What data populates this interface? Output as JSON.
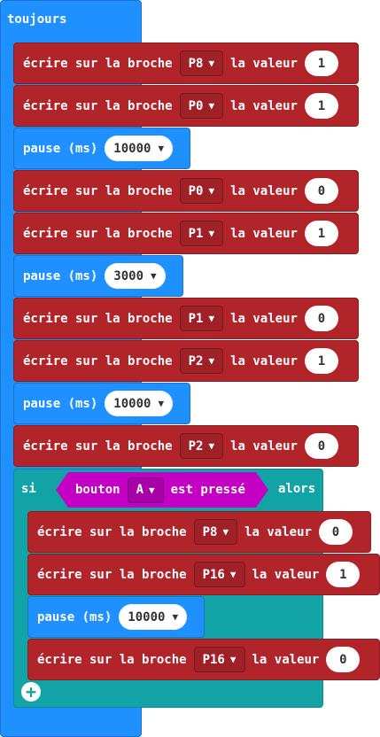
{
  "forever": {
    "label": "toujours"
  },
  "blocks": [
    {
      "label": "écrire sur la broche",
      "pin": "P8",
      "mid": "la valeur",
      "value": "1"
    },
    {
      "label": "écrire sur la broche",
      "pin": "P0",
      "mid": "la valeur",
      "value": "1"
    },
    {
      "label": "pause (ms)",
      "value": "10000"
    },
    {
      "label": "écrire sur la broche",
      "pin": "P0",
      "mid": "la valeur",
      "value": "0"
    },
    {
      "label": "écrire sur la broche",
      "pin": "P1",
      "mid": "la valeur",
      "value": "1"
    },
    {
      "label": "pause (ms)",
      "value": "3000"
    },
    {
      "label": "écrire sur la broche",
      "pin": "P1",
      "mid": "la valeur",
      "value": "0"
    },
    {
      "label": "écrire sur la broche",
      "pin": "P2",
      "mid": "la valeur",
      "value": "1"
    },
    {
      "label": "pause (ms)",
      "value": "10000"
    },
    {
      "label": "écrire sur la broche",
      "pin": "P2",
      "mid": "la valeur",
      "value": "0"
    }
  ],
  "if": {
    "si": "si",
    "condition": {
      "prefix": "bouton",
      "button": "A",
      "suffix": "est pressé"
    },
    "alors": "alors",
    "inner": [
      {
        "label": "écrire sur la broche",
        "pin": "P8",
        "mid": "la valeur",
        "value": "0"
      },
      {
        "label": "écrire sur la broche",
        "pin": "P16",
        "mid": "la valeur",
        "value": "1"
      },
      {
        "label": "pause (ms)",
        "value": "10000"
      },
      {
        "label": "écrire sur la broche",
        "pin": "P16",
        "mid": "la valeur",
        "value": "0"
      }
    ],
    "add_icon": "plus-circle-icon"
  },
  "dropdown_icon": "caret-down-icon",
  "colors": {
    "pins": "#b0242a",
    "loops": "#1e90ff",
    "logic": "#11a3a6",
    "input": "#c400c4"
  }
}
